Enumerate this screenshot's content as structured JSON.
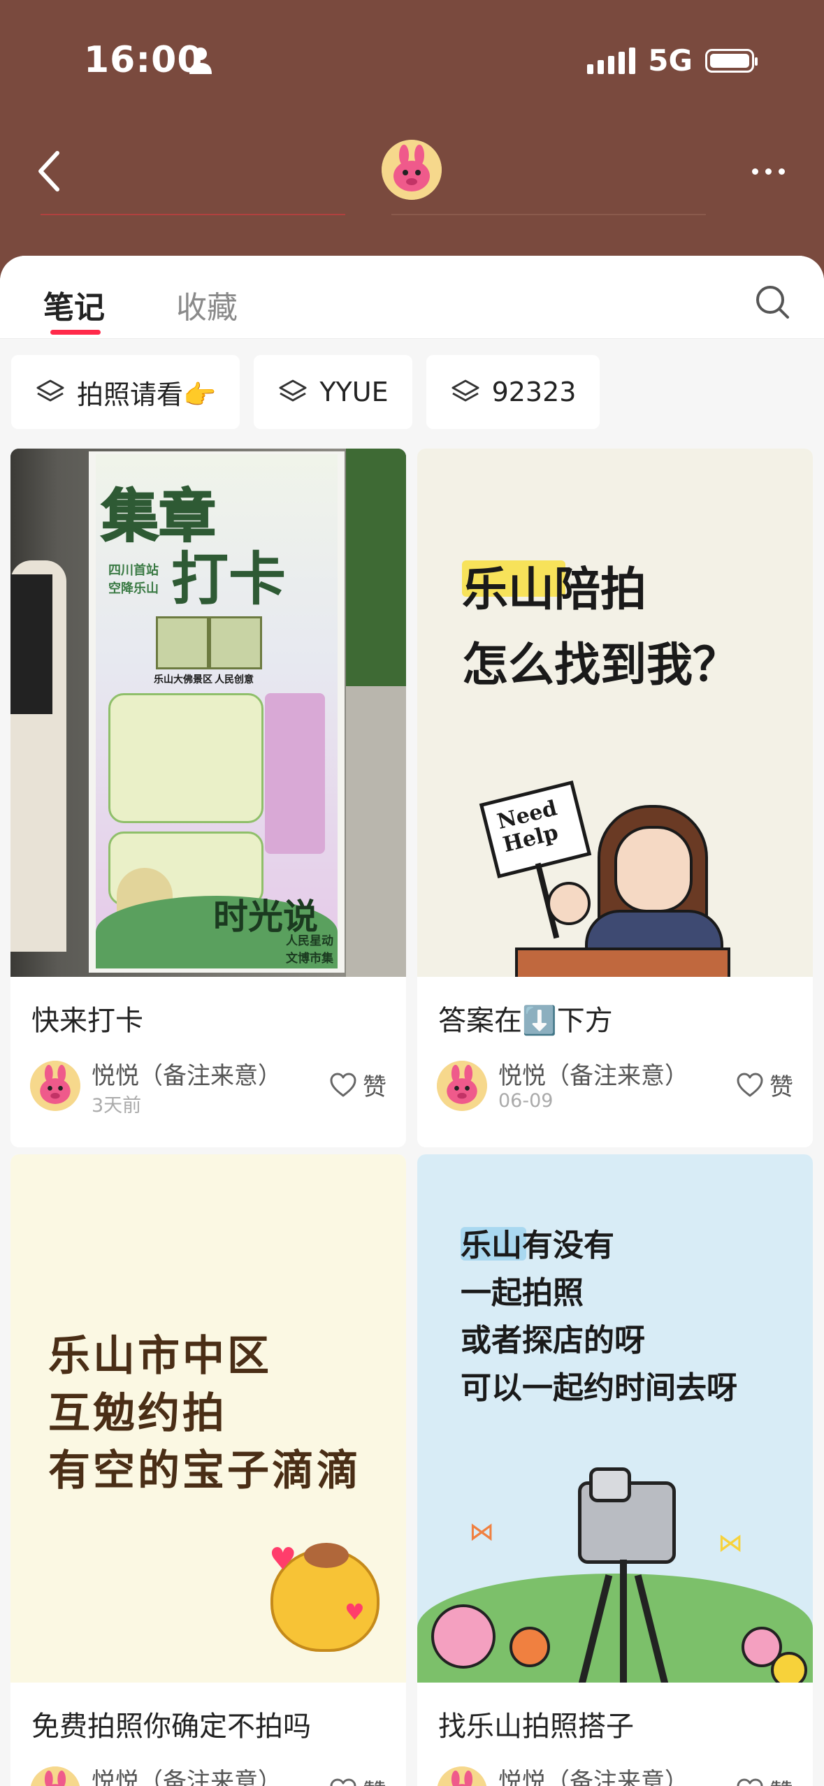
{
  "status_bar": {
    "time": "16:00",
    "network": "5G",
    "icons": [
      "person-icon",
      "signal-icon",
      "battery-icon"
    ]
  },
  "header": {
    "icons": [
      "back-arrow-icon",
      "profile-avatar",
      "more-icon"
    ]
  },
  "tabs": [
    {
      "label": "笔记",
      "active": true
    },
    {
      "label": "收藏",
      "active": false
    }
  ],
  "chips": [
    {
      "label": "拍照请看👉",
      "icon": "layers-icon"
    },
    {
      "label": "YYUE",
      "icon": "layers-icon"
    },
    {
      "label": "92323",
      "icon": "layers-icon"
    }
  ],
  "cards": [
    {
      "title": "快来打卡",
      "author": "悦悦（备注来意）",
      "date": "3天前",
      "like_label": "赞",
      "poster": {
        "heading1": "集章",
        "heading2": "打卡",
        "sub": "四川首站 空降乐山",
        "qr1": "乐山大佛景区",
        "qr2": "人民创意",
        "signature": "时光说",
        "signature_sub": "人民星动 文博市集"
      }
    },
    {
      "title": "答案在⬇️下方",
      "author": "悦悦（备注来意）",
      "date": "06-09",
      "like_label": "赞",
      "poster": {
        "line1_hl": "乐山",
        "line1_rest": "陪拍",
        "line2": "怎么找到我？",
        "sign": "Need Help"
      }
    },
    {
      "title": "免费拍照你确定不拍吗",
      "author": "悦悦（备注来意）",
      "date": "",
      "like_label": "赞",
      "poster": {
        "line1": "乐山市中区",
        "line2": "互勉约拍",
        "line3": "有空的宝子滴滴"
      }
    },
    {
      "title": "找乐山拍照搭子",
      "author": "悦悦（备注来意）",
      "date": "",
      "like_label": "赞",
      "poster": {
        "line1_hl": "乐山",
        "line1_rest": "有没有",
        "line2": "一起拍照",
        "line3": "或者探店的呀",
        "line4": "可以一起约时间去呀"
      }
    }
  ],
  "colors": {
    "header_bg": "#7a4a3e",
    "accent": "#ff2a4a",
    "highlight_yellow": "#f7e25a",
    "highlight_blue": "#a9d8f0",
    "poster_blue_bg": "#d8ecf6",
    "poster_cream_bg": "#f3f1e6",
    "poster_yellow_bg": "#fbf8e3"
  }
}
